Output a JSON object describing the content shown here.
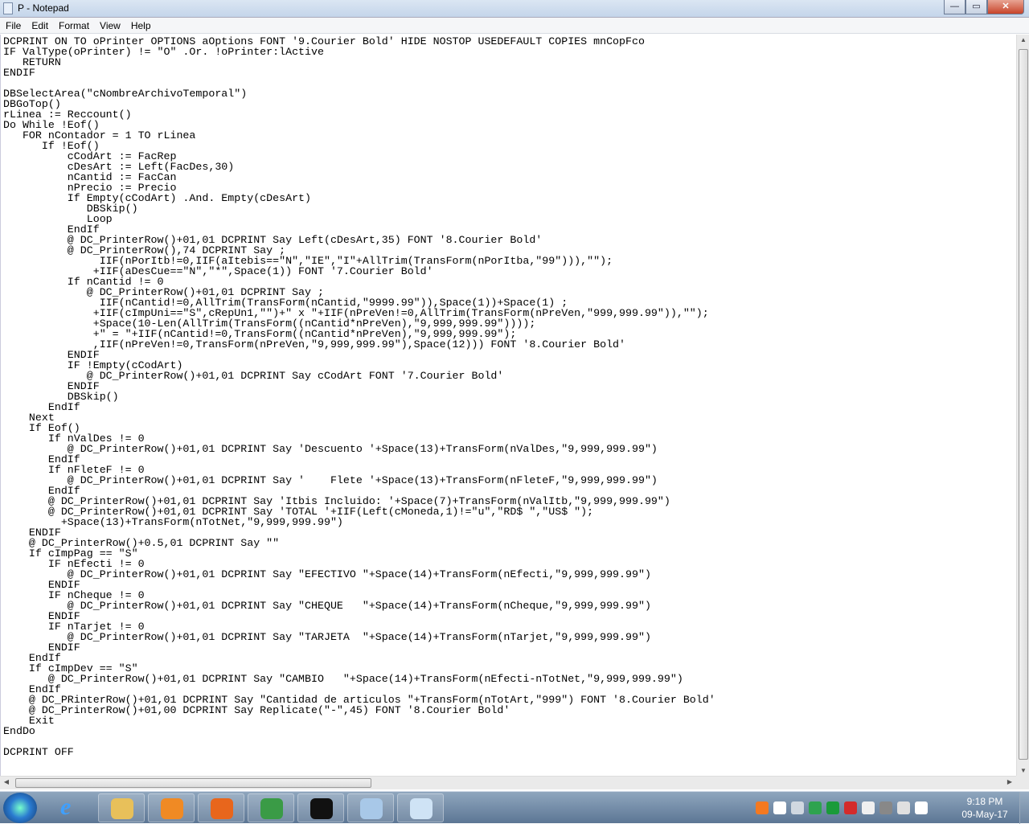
{
  "window": {
    "title": "P - Notepad",
    "minimize": "—",
    "maximize": "▭",
    "close": "✕"
  },
  "menu": [
    "File",
    "Edit",
    "Format",
    "View",
    "Help"
  ],
  "code_lines": [
    "DCPRINT ON TO oPrinter OPTIONS aOptions FONT '9.Courier Bold' HIDE NOSTOP USEDEFAULT COPIES mnCopFco",
    "IF ValType(oPrinter) != \"O\" .Or. !oPrinter:lActive",
    "   RETURN",
    "ENDIF",
    "",
    "DBSelectArea(\"cNombreArchivoTemporal\")",
    "DBGoTop()",
    "rLinea := Reccount()",
    "Do While !Eof()",
    "   FOR nContador = 1 TO rLinea",
    "      If !Eof()",
    "          cCodArt := FacRep",
    "          cDesArt := Left(FacDes,30)",
    "          nCantid := FacCan",
    "          nPrecio := Precio",
    "          If Empty(cCodArt) .And. Empty(cDesArt)",
    "             DBSkip()",
    "             Loop",
    "          EndIf",
    "          @ DC_PrinterRow()+01,01 DCPRINT Say Left(cDesArt,35) FONT '8.Courier Bold'",
    "          @ DC_PrinterRow(),74 DCPRINT Say ;",
    "               IIF(nPorItb!=0,IIF(aItebis==\"N\",\"IE\",\"I\"+AllTrim(TransForm(nPorItba,\"99\"))),\"\");",
    "              +IIF(aDesCue==\"N\",\"*\",Space(1)) FONT '7.Courier Bold'",
    "          If nCantid != 0",
    "             @ DC_PrinterRow()+01,01 DCPRINT Say ;",
    "               IIF(nCantid!=0,AllTrim(TransForm(nCantid,\"9999.99\")),Space(1))+Space(1) ;",
    "              +IIF(cImpUni==\"S\",cRepUn1,\"\")+\" x \"+IIF(nPreVen!=0,AllTrim(TransForm(nPreVen,\"999,999.99\")),\"\");",
    "              +Space(10-Len(AllTrim(TransForm((nCantid*nPreVen),\"9,999,999.99\"))));",
    "              +\" = \"+IIF(nCantid!=0,TransForm((nCantid*nPreVen),\"9,999,999.99\");",
    "              ,IIF(nPreVen!=0,TransForm(nPreVen,\"9,999,999.99\"),Space(12))) FONT '8.Courier Bold'",
    "          ENDIF",
    "          IF !Empty(cCodArt)",
    "             @ DC_PrinterRow()+01,01 DCPRINT Say cCodArt FONT '7.Courier Bold'",
    "          ENDIF",
    "          DBSkip()",
    "       EndIf",
    "    Next",
    "    If Eof()",
    "       If nValDes != 0",
    "          @ DC_PrinterRow()+01,01 DCPRINT Say 'Descuento '+Space(13)+TransForm(nValDes,\"9,999,999.99\")",
    "       EndIf",
    "       If nFleteF != 0",
    "          @ DC_PrinterRow()+01,01 DCPRINT Say '    Flete '+Space(13)+TransForm(nFleteF,\"9,999,999.99\")",
    "       EndIf",
    "       @ DC_PrinterRow()+01,01 DCPRINT Say 'Itbis Incluido: '+Space(7)+TransForm(nValItb,\"9,999,999.99\")",
    "       @ DC_PrinterRow()+01,01 DCPRINT Say 'TOTAL '+IIF(Left(cMoneda,1)!=\"u\",\"RD$ \",\"US$ \");",
    "         +Space(13)+TransForm(nTotNet,\"9,999,999.99\")",
    "    ENDIF",
    "    @ DC_PrinterRow()+0.5,01 DCPRINT Say \"\"",
    "    If cImpPag == \"S\"",
    "       IF nEfecti != 0",
    "          @ DC_PrinterRow()+01,01 DCPRINT Say \"EFECTIVO \"+Space(14)+TransForm(nEfecti,\"9,999,999.99\")",
    "       ENDIF",
    "       IF nCheque != 0",
    "          @ DC_PrinterRow()+01,01 DCPRINT Say \"CHEQUE   \"+Space(14)+TransForm(nCheque,\"9,999,999.99\")",
    "       ENDIF",
    "       IF nTarjet != 0",
    "          @ DC_PrinterRow()+01,01 DCPRINT Say \"TARJETA  \"+Space(14)+TransForm(nTarjet,\"9,999,999.99\")",
    "       ENDIF",
    "    EndIf",
    "    If cImpDev == \"S\"",
    "       @ DC_PrinterRow()+01,01 DCPRINT Say \"CAMBIO   \"+Space(14)+TransForm(nEfecti-nTotNet,\"9,999,999.99\")",
    "    EndIf",
    "    @ DC_PRinterRow()+01,01 DCPRINT Say \"Cantidad de articulos \"+TransForm(nTotArt,\"999\") FONT '8.Courier Bold'",
    "    @ DC_PrinterRow()+01,00 DCPRINT Say Replicate(\"-\",45) FONT '8.Courier Bold'",
    "    Exit",
    "EndDo",
    "",
    "DCPRINT OFF"
  ],
  "taskbar": {
    "apps": [
      {
        "name": "windows-explorer",
        "color": "#e8c05a"
      },
      {
        "name": "media-player",
        "color": "#f08a24"
      },
      {
        "name": "firefox",
        "color": "#e8661c"
      },
      {
        "name": "chrome",
        "color": "#3a9b46"
      },
      {
        "name": "command-prompt",
        "color": "#111111"
      },
      {
        "name": "paint",
        "color": "#a8c8e8"
      },
      {
        "name": "notepad",
        "color": "#cfe3f5"
      }
    ],
    "tray": [
      {
        "name": "avast",
        "color": "#f47920"
      },
      {
        "name": "icloud",
        "color": "#ffffff"
      },
      {
        "name": "dropbox",
        "color": "#d0d8e0"
      },
      {
        "name": "google-drive",
        "color": "#2ea34f"
      },
      {
        "name": "sync",
        "color": "#1a9b3a"
      },
      {
        "name": "security-shield",
        "color": "#d42b2b"
      },
      {
        "name": "action-center-flag",
        "color": "#f0f0f0"
      },
      {
        "name": "usb-device",
        "color": "#888888"
      },
      {
        "name": "network",
        "color": "#e0e0e0"
      },
      {
        "name": "volume",
        "color": "#ffffff"
      }
    ],
    "clock": {
      "time": "9:18 PM",
      "date": "09-May-17"
    }
  }
}
